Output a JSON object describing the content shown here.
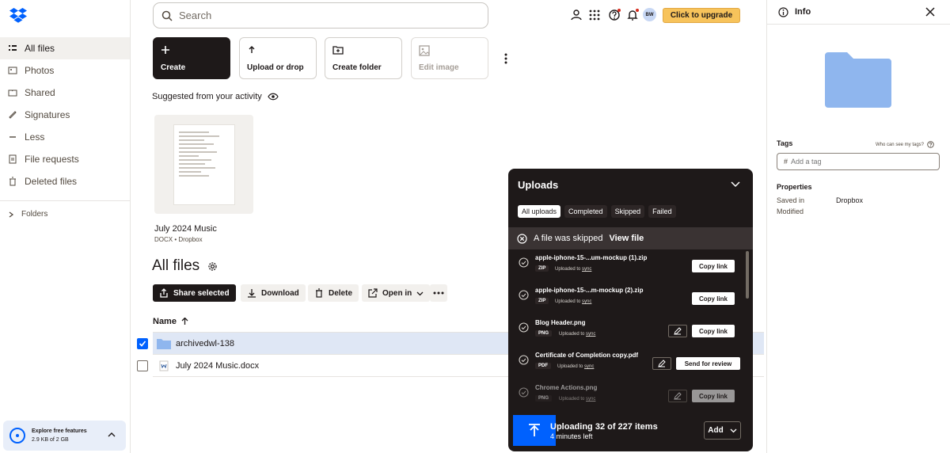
{
  "sidebar": {
    "items": [
      {
        "label": "All files",
        "icon": "folder-list-icon"
      },
      {
        "label": "Photos",
        "icon": "photo-icon"
      },
      {
        "label": "Shared",
        "icon": "shared-icon"
      },
      {
        "label": "Signatures",
        "icon": "signature-icon"
      },
      {
        "label": "Less",
        "icon": "chevron-up-icon"
      },
      {
        "label": "File requests",
        "icon": "file-request-icon"
      },
      {
        "label": "Deleted files",
        "icon": "trash-icon"
      }
    ],
    "folders_label": "Folders",
    "promo": {
      "line1": "Explore free features",
      "line2": "2.9 KB of 2 GB"
    }
  },
  "topbar": {
    "search_placeholder": "Search",
    "avatar_initials": "BW",
    "upgrade_label": "Click to upgrade"
  },
  "tiles": {
    "create": "Create",
    "upload": "Upload or drop",
    "create_folder": "Create folder",
    "edit_image": "Edit image"
  },
  "suggested": {
    "title": "Suggested from your activity",
    "file_name": "July 2024 Music",
    "file_meta": "DOCX • Dropbox"
  },
  "files": {
    "heading": "All files",
    "actions": {
      "share": "Share selected",
      "download": "Download",
      "delete": "Delete",
      "open_in": "Open in"
    },
    "column_name": "Name",
    "rows": [
      {
        "name": "archivedwl-138",
        "type": "folder",
        "selected": true
      },
      {
        "name": "July 2024 Music.docx",
        "type": "docx",
        "selected": false
      }
    ]
  },
  "uploads": {
    "title": "Uploads",
    "filters": [
      "All uploads",
      "Completed",
      "Skipped",
      "Failed"
    ],
    "skipped_msg": "A file was skipped",
    "view_file": "View file",
    "items": [
      {
        "name": "apple-iphone-15-...um-mockup (1).zip",
        "ext": "ZIP",
        "loc_prefix": "Uploaded to",
        "loc": "sync",
        "action": "Copy link",
        "edit": false
      },
      {
        "name": "apple-iphone-15-...m-mockup (2).zip",
        "ext": "ZIP",
        "loc_prefix": "Uploaded to",
        "loc": "sync",
        "action": "Copy link",
        "edit": false
      },
      {
        "name": "Blog Header.png",
        "ext": "PNG",
        "loc_prefix": "Uploaded to",
        "loc": "sync",
        "action": "Copy link",
        "edit": true
      },
      {
        "name": "Certificate of Completion copy.pdf",
        "ext": "PDF",
        "loc_prefix": "Uploaded to",
        "loc": "sync",
        "action": "Send for review",
        "edit": true
      },
      {
        "name": "Chrome Actions.png",
        "ext": "PNG",
        "loc_prefix": "Uploaded to",
        "loc": "sync",
        "action": "Copy link",
        "edit": true
      }
    ],
    "status_main": "Uploading 32 of 227 items",
    "status_sub": "4 minutes left",
    "add_label": "Add"
  },
  "info": {
    "title": "Info",
    "tags_label": "Tags",
    "who_tags": "Who can see my tags?",
    "tag_placeholder": "Add a tag",
    "properties_label": "Properties",
    "saved_in_key": "Saved in",
    "saved_in_val": "Dropbox",
    "modified_key": "Modified"
  },
  "colors": {
    "brand_blue": "#0061fe",
    "upgrade_yellow": "#f7c35b",
    "dark": "#1e1919",
    "selected_row": "#dfe7f5",
    "folder": "#8fb6ee"
  }
}
